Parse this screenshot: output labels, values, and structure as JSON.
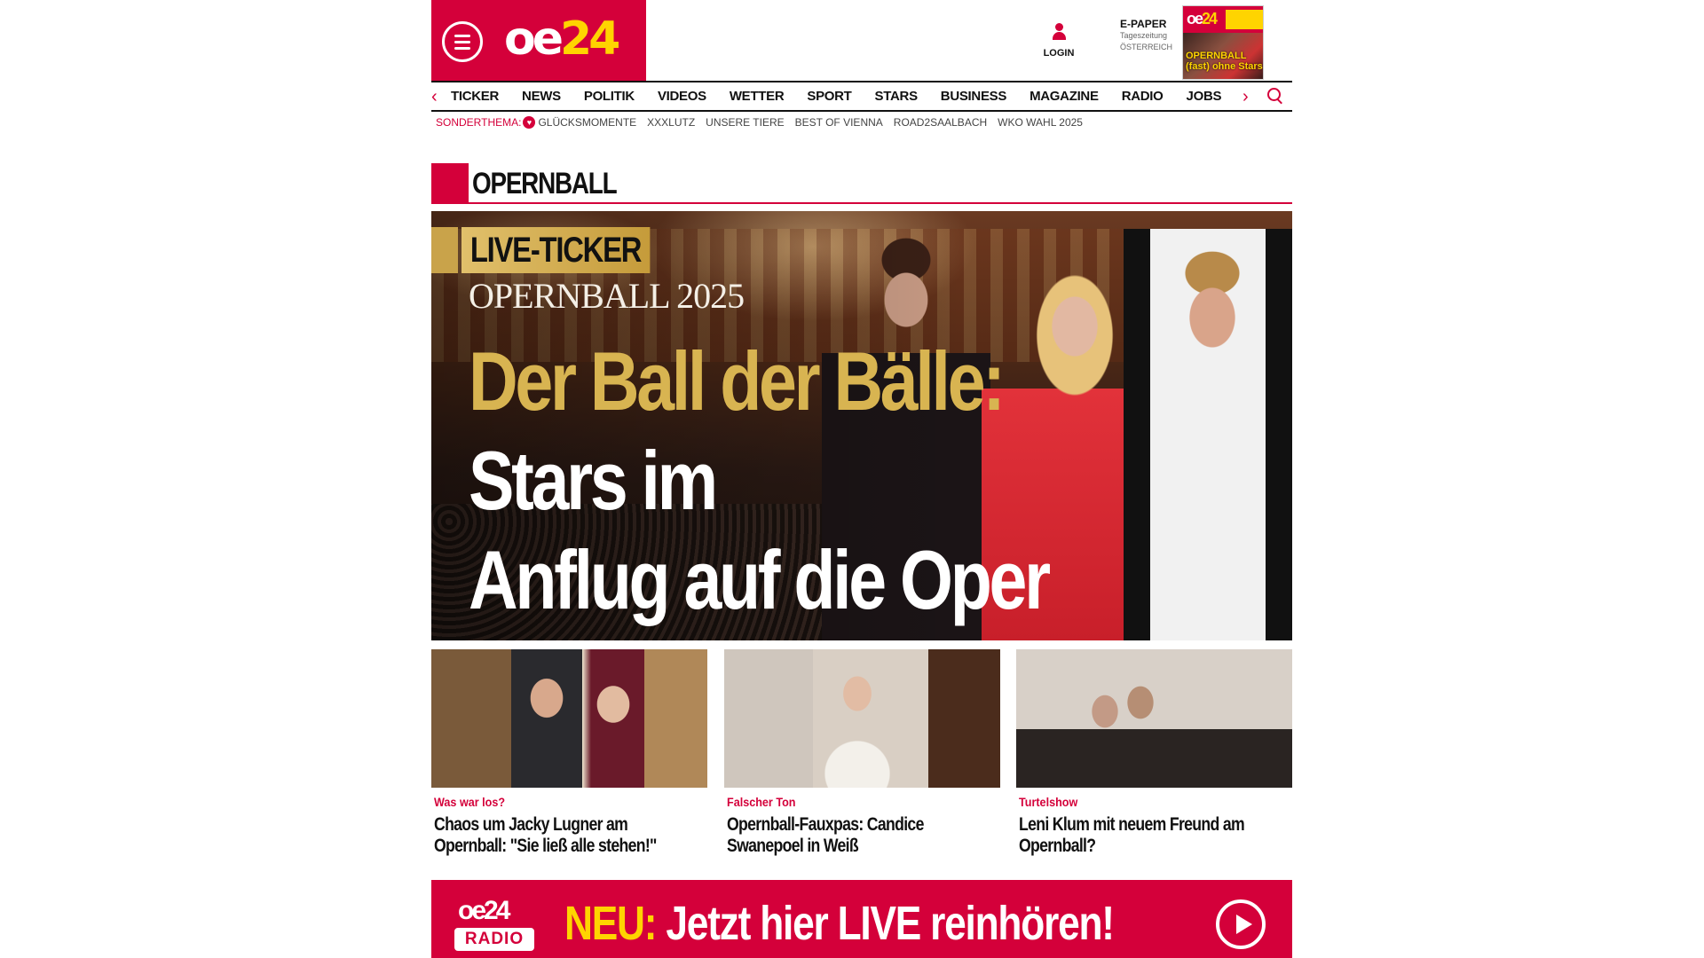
{
  "header": {
    "logo": {
      "oe": "oe",
      "num": "24"
    },
    "login_label": "LOGIN",
    "epaper": {
      "title": "E-PAPER",
      "line1": "Tageszeitung",
      "line2": "ÖSTERREICH"
    },
    "epaper_cover": {
      "logo_oe": "oe",
      "logo_num": "24",
      "headline": "OPERNBALL (fast) ohne Stars"
    }
  },
  "nav": {
    "items": [
      "TICKER",
      "NEWS",
      "POLITIK",
      "VIDEOS",
      "WETTER",
      "SPORT",
      "STARS",
      "BUSINESS",
      "MAGAZINE",
      "RADIO",
      "JOBS"
    ]
  },
  "subnav": {
    "label": "SONDERTHEMA:",
    "items": [
      "GLÜCKSMOMENTE",
      "XXXLUTZ",
      "UNSERE TIERE",
      "BEST OF VIENNA",
      "ROAD2SAALBACH",
      "WKO WAHL 2025"
    ]
  },
  "section": {
    "title": "OPERNBALL"
  },
  "hero": {
    "badge": "LIVE-TICKER",
    "eyebrow": "OPERNBALL 2025",
    "headline_gold": "Der Ball der Bälle:",
    "headline_white_1": "Stars im",
    "headline_white_2": "Anflug auf die Oper"
  },
  "cards": [
    {
      "kicker": "Was war los?",
      "title": "Chaos um Jacky Lugner am Opernball: \"Sie ließ alle stehen!\""
    },
    {
      "kicker": "Falscher Ton",
      "title": "Opernball-Fauxpas: Candice Swanepoel in Weiß"
    },
    {
      "kicker": "Turtelshow",
      "title": "Leni Klum mit neuem Freund am Opernball?"
    }
  ],
  "banner": {
    "logo_oe": "oe",
    "logo_num": "24",
    "logo_radio": "RADIO",
    "neu": "NEU:",
    "text": "Jetzt hier LIVE reinhören!"
  },
  "colors": {
    "brand": "#d4003a",
    "accent_yellow": "#ffd400",
    "gold": "#d8b451"
  }
}
